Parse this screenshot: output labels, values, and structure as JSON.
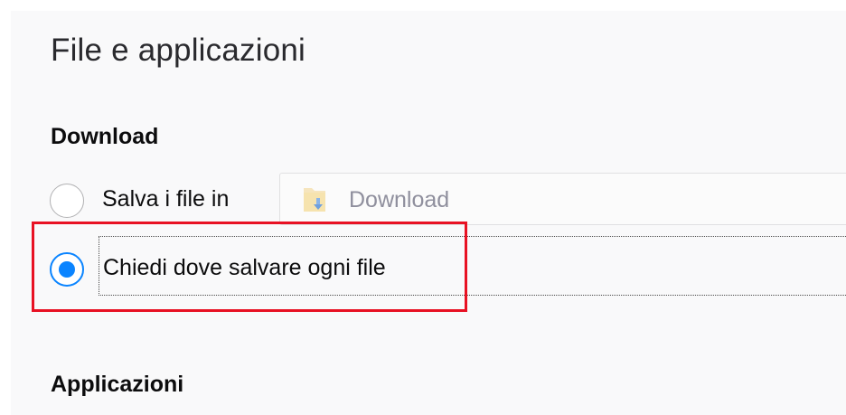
{
  "page": {
    "title": "File e applicazioni"
  },
  "downloads": {
    "heading": "Download",
    "save_option": {
      "label": "Salva i file in",
      "selected": false
    },
    "folder": {
      "label": "Download",
      "icon": "download-folder-icon"
    },
    "ask_option": {
      "label": "Chiedi dove salvare ogni file",
      "selected": true
    }
  },
  "applications": {
    "heading": "Applicazioni"
  },
  "colors": {
    "accent": "#0a84ff",
    "highlight": "#e81123",
    "panel_background": "#f9f9fa"
  }
}
